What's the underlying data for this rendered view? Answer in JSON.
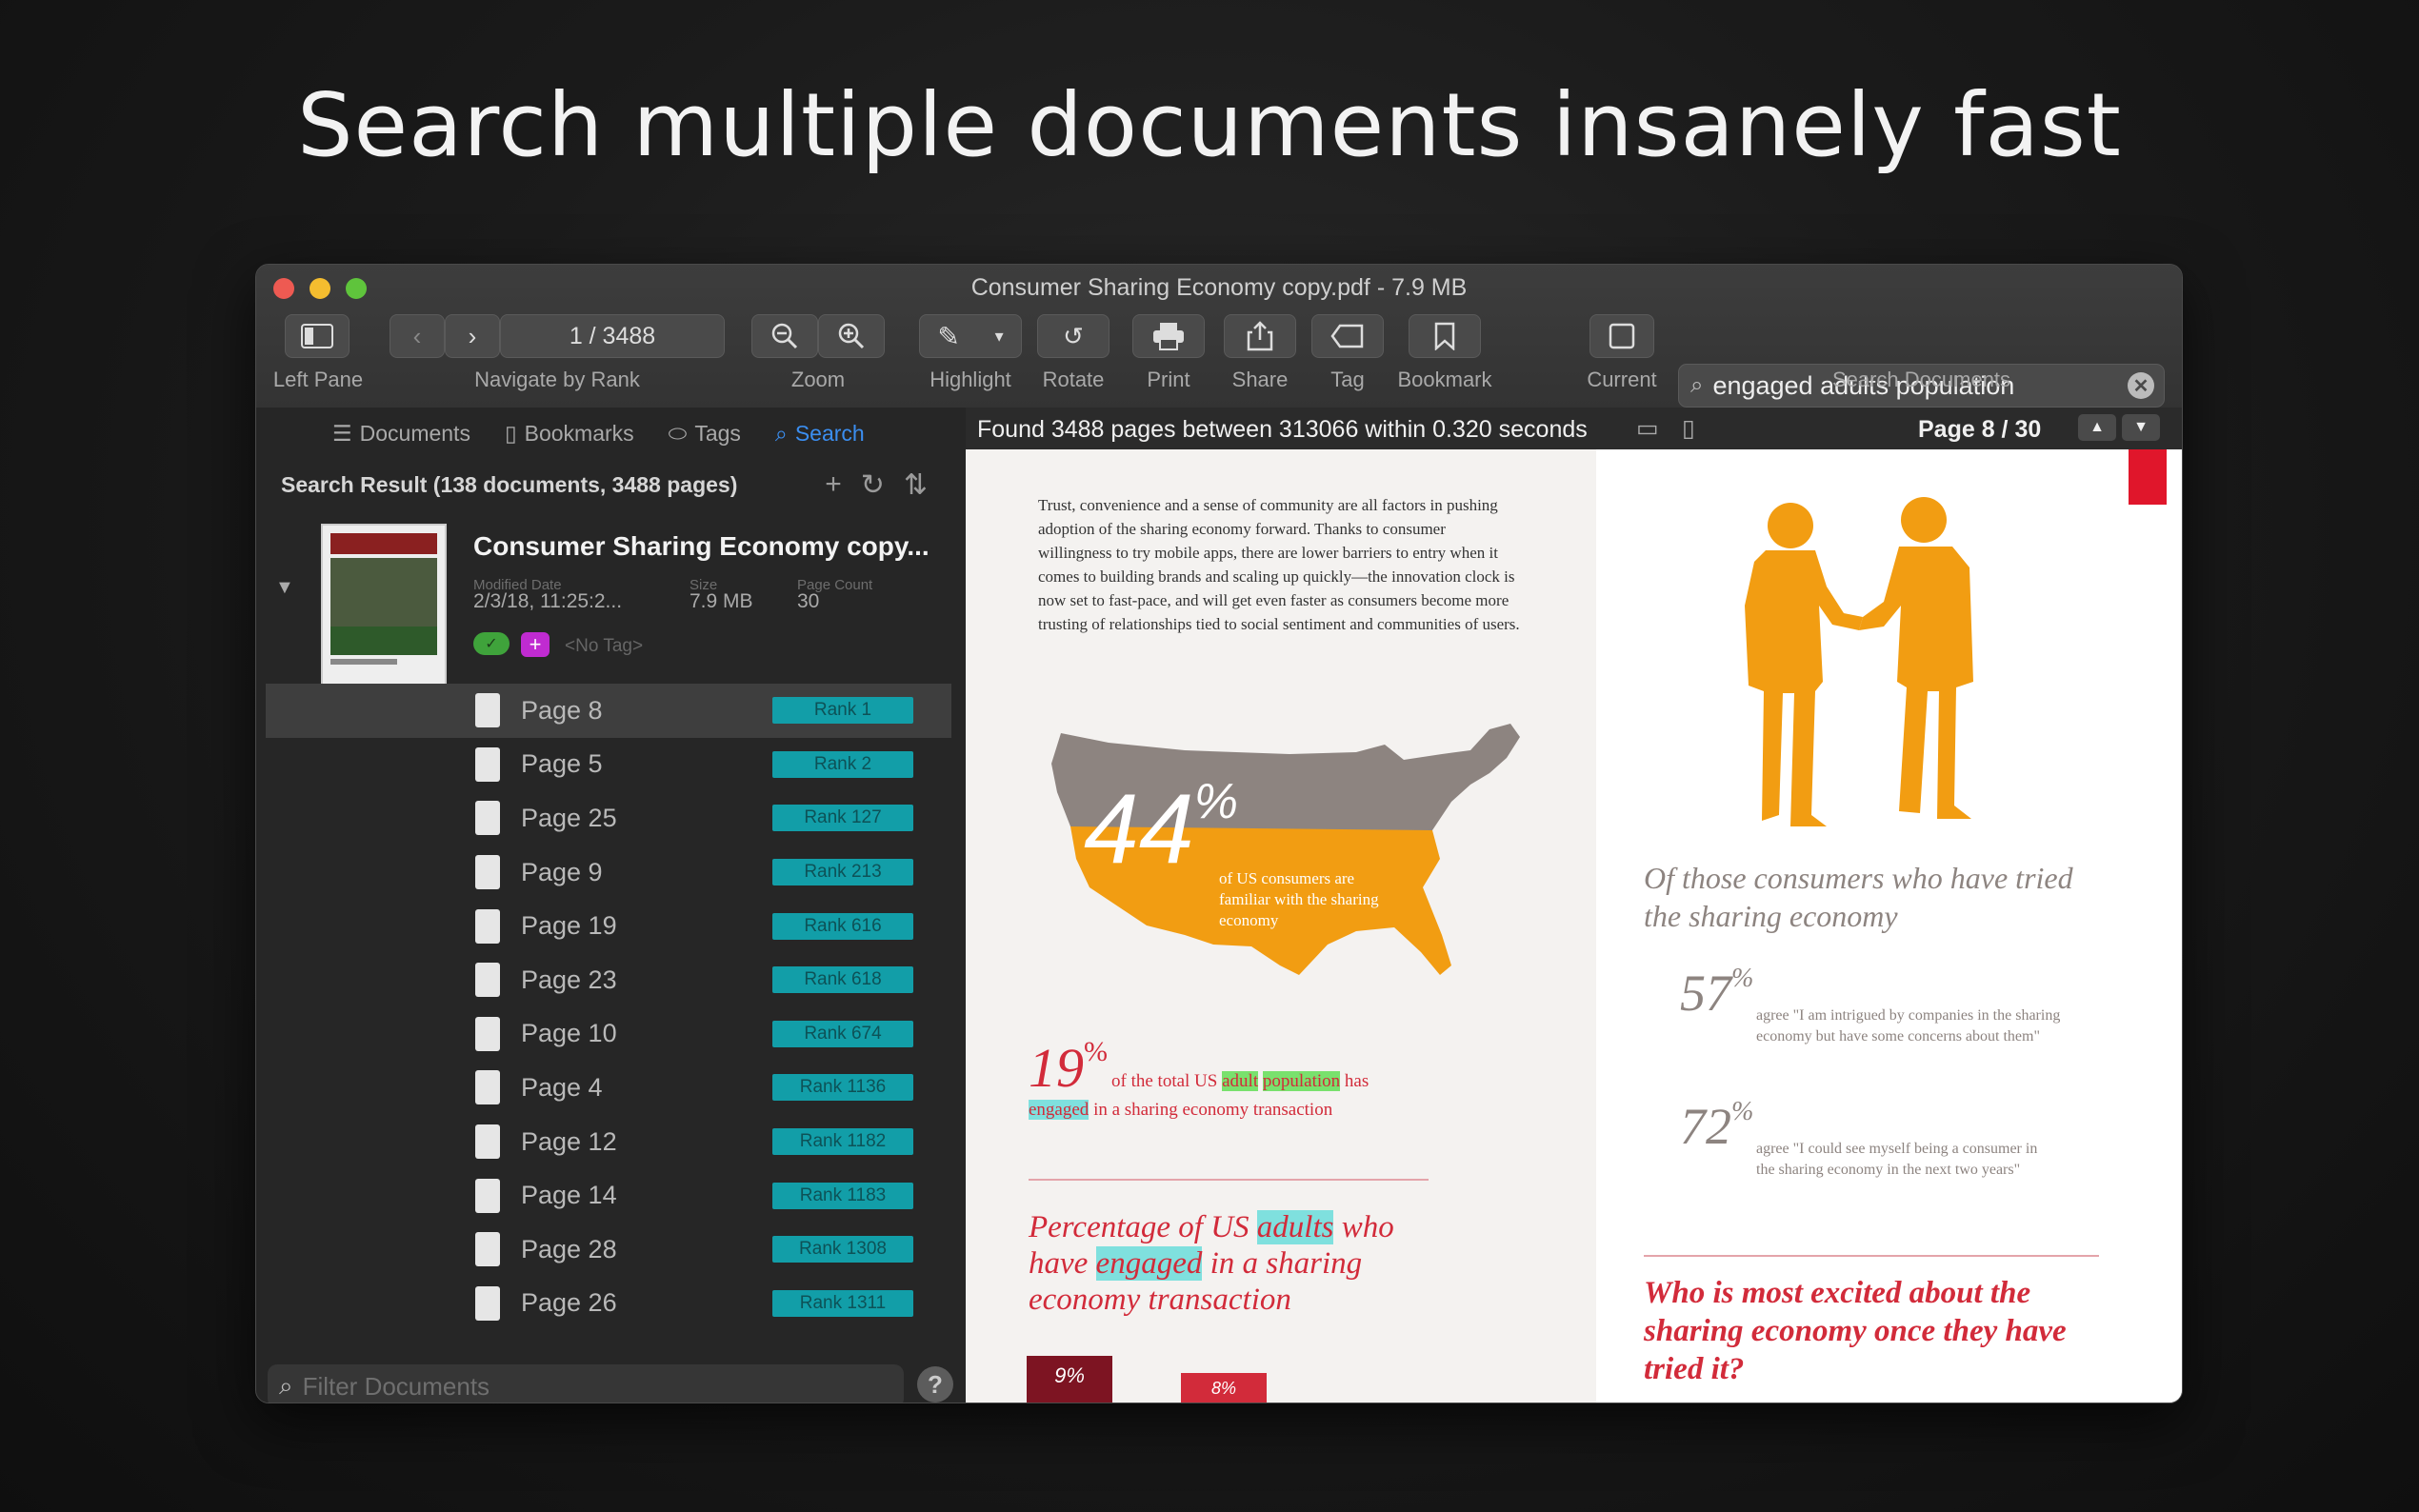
{
  "headline": "Search multiple documents insanely fast",
  "window": {
    "title": "Consumer Sharing Economy copy.pdf - 7.9 MB",
    "traffic_colors": [
      "#ee5a52",
      "#f4bd2f",
      "#5fc43c"
    ]
  },
  "toolbar": {
    "page_counter": "1 / 3488",
    "labels": {
      "left_pane": "Left Pane",
      "navigate": "Navigate by Rank",
      "zoom": "Zoom",
      "highlight": "Highlight",
      "rotate": "Rotate",
      "print": "Print",
      "share": "Share",
      "tag": "Tag",
      "bookmark": "Bookmark",
      "current": "Current",
      "search_documents": "Search Documents"
    },
    "search_value": "engaged adults population"
  },
  "sidebar": {
    "tabs": [
      "Documents",
      "Bookmarks",
      "Tags",
      "Search"
    ],
    "active_tab": "Search",
    "result_header": "Search Result (138 documents, 3488 pages)",
    "document": {
      "title": "Consumer Sharing Economy copy...",
      "modified_label": "Modified Date",
      "modified": "2/3/18, 11:25:2...",
      "size_label": "Size",
      "size": "7.9 MB",
      "page_count_label": "Page Count",
      "page_count": "30",
      "no_tag": "<No Tag>"
    },
    "results": [
      {
        "page": "Page 8",
        "rank": "Rank 1"
      },
      {
        "page": "Page 5",
        "rank": "Rank 2"
      },
      {
        "page": "Page 25",
        "rank": "Rank 127"
      },
      {
        "page": "Page 9",
        "rank": "Rank 213"
      },
      {
        "page": "Page 19",
        "rank": "Rank 616"
      },
      {
        "page": "Page 23",
        "rank": "Rank 618"
      },
      {
        "page": "Page 10",
        "rank": "Rank 674"
      },
      {
        "page": "Page 4",
        "rank": "Rank 1136"
      },
      {
        "page": "Page 12",
        "rank": "Rank 1182"
      },
      {
        "page": "Page 14",
        "rank": "Rank 1183"
      },
      {
        "page": "Page 28",
        "rank": "Rank 1308"
      },
      {
        "page": "Page 26",
        "rank": "Rank 1311"
      }
    ],
    "filter_placeholder": "Filter Documents",
    "help": "?"
  },
  "viewer": {
    "found_text": "Found 3488 pages between 313066 within 0.320 seconds",
    "page_indicator": "Page 8 / 30",
    "intro_paragraph": "Trust, convenience and a sense of community are all factors in pushing adoption of the sharing economy forward. Thanks to consumer willingness to try mobile apps, there are lower barriers to entry when it comes to building brands and scaling up quickly—the innovation clock is now set to fast-pace, and will get even faster as consumers become more trusting of relationships tied to social sentiment and communities of users.",
    "stat44": {
      "value": "44",
      "pct": "%",
      "caption": "of US consumers are familiar with the sharing economy"
    },
    "stat19": {
      "value": "19",
      "pct": "%",
      "pre": "of the total US",
      "adult": "adult",
      "population": "population",
      "has": "has",
      "engaged": "engaged",
      "rest": "in a sharing economy transaction"
    },
    "pct_heading": {
      "l1a": "Percentage of US",
      "adults": "adults",
      "l1b": "who",
      "l2a": "have",
      "engaged": "engaged",
      "l2b": "in a sharing",
      "l3": "economy transaction"
    },
    "bar_labels": [
      "9%",
      "8%"
    ],
    "right_heading": "Of those consumers who have tried the sharing economy",
    "stat57": {
      "value": "57",
      "pct": "%",
      "quote": "agree \"I am intrigued by companies in the sharing economy but have some concerns about them\""
    },
    "stat72": {
      "value": "72",
      "pct": "%",
      "quote": "agree \"I could see myself being a consumer in the sharing economy in the next two years\""
    },
    "right_question": "Who is most excited about the sharing economy once they have tried it?",
    "colors": {
      "orange": "#f29d12",
      "gray": "#8d8480",
      "red": "#d22b3a",
      "teal": "#129ea8"
    }
  }
}
